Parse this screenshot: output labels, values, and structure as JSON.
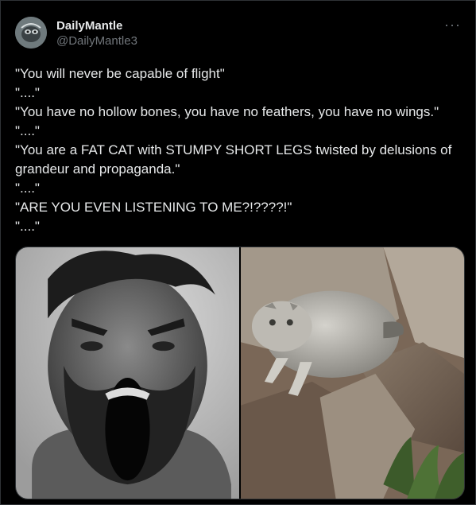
{
  "author": {
    "display_name": "DailyMantle",
    "handle": "@DailyMantle3",
    "avatar": "avatar-image"
  },
  "more_icon": "more-horizontal-icon",
  "more_glyph": "···",
  "lines": [
    "\"You will never be capable of flight\"",
    "\"....\"",
    "\"You have no hollow bones, you have no feathers, you have no wings.\"",
    "\"....\"",
    "\"You are a FAT CAT with STUMPY SHORT LEGS twisted by delusions of grandeur and propaganda.\"",
    "\"....\"",
    "\"ARE YOU EVEN LISTENING TO ME?!????!\"",
    "\"....\""
  ],
  "media": [
    {
      "name": "shouting-man-photo",
      "description_visual": true
    },
    {
      "name": "jumping-cat-photo",
      "description_visual": true
    }
  ],
  "colors": {
    "background": "#000000",
    "text": "#e7e9ea",
    "secondary_text": "#71767b",
    "border": "#2f3336"
  }
}
